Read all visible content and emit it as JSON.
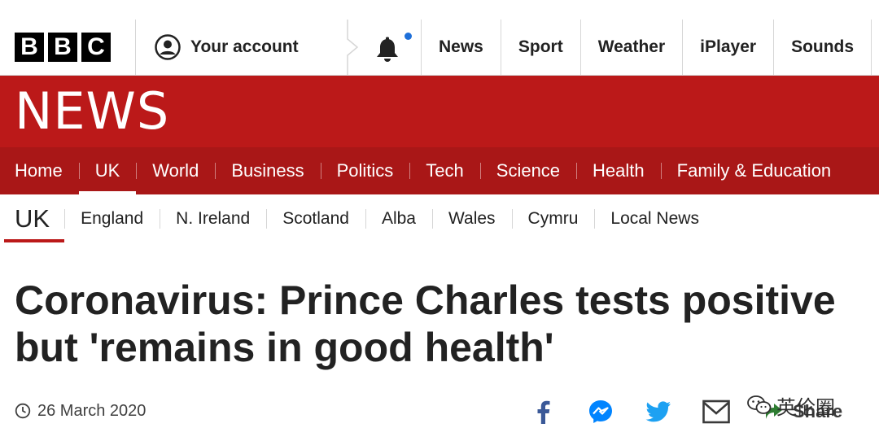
{
  "masthead": {
    "logo_letters": [
      "B",
      "B",
      "C"
    ],
    "account_label": "Your account",
    "nav": [
      "News",
      "Sport",
      "Weather",
      "iPlayer",
      "Sounds"
    ]
  },
  "banner": {
    "wordmark": "NEWS"
  },
  "main_nav": {
    "items": [
      "Home",
      "UK",
      "World",
      "Business",
      "Politics",
      "Tech",
      "Science",
      "Health",
      "Family & Education"
    ],
    "active": "UK"
  },
  "sub_nav": {
    "current": "UK",
    "items": [
      "England",
      "N. Ireland",
      "Scotland",
      "Alba",
      "Wales",
      "Cymru",
      "Local News"
    ]
  },
  "article": {
    "headline": "Coronavirus: Prince Charles tests positive but 'remains in good health'",
    "date": "26 March 2020"
  },
  "share": {
    "icons": [
      "facebook-icon",
      "messenger-icon",
      "twitter-icon",
      "email-icon"
    ],
    "label": "Share"
  },
  "watermark": {
    "text": "英伦圈"
  },
  "colors": {
    "brand_red": "#bb1919",
    "nav_red": "#a91717",
    "facebook": "#3b5998",
    "messenger": "#0084ff",
    "twitter": "#1da1f2",
    "notification_dot": "#1e6fd9"
  }
}
